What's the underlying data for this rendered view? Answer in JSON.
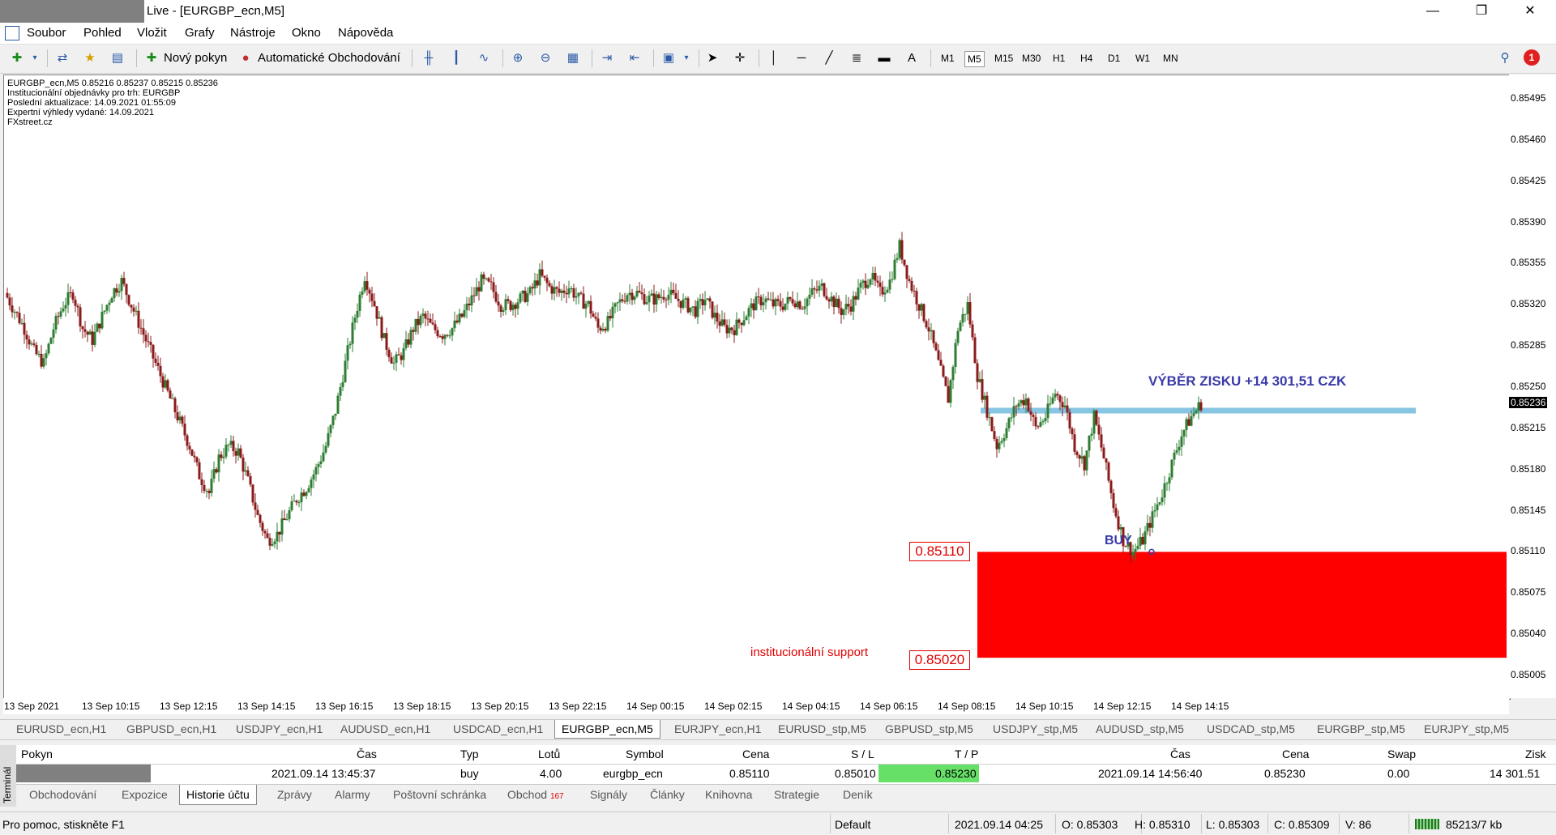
{
  "window": {
    "title": "Live - [EURGBP_ecn,M5]",
    "minimize": "—",
    "maximize": "❐",
    "close": "✕"
  },
  "menu": [
    "Soubor",
    "Pohled",
    "Vložit",
    "Grafy",
    "Nástroje",
    "Okno",
    "Nápověda"
  ],
  "toolbar": {
    "new_order": "Nový pokyn",
    "auto_trading": "Automatické Obchodování",
    "timeframes": [
      "M1",
      "M5",
      "M15",
      "M30",
      "H1",
      "H4",
      "D1",
      "W1",
      "MN"
    ],
    "active_timeframe": "M5",
    "text_tool": "A",
    "notifications": "1"
  },
  "chart_info": [
    "EURGBP_ecn,M5  0.85216 0.85237 0.85215 0.85236",
    "Institucionální objednávky pro trh: EURGBP",
    "Poslední aktualizace: 14.09.2021 01:55:09",
    "Expertní výhledy vydané: 14.09.2021",
    "FXstreet.cz"
  ],
  "annotations": {
    "take_profit": "VÝBĚR ZISKU +14 301,51 CZK",
    "buy": "BUY",
    "zone_label": "institucionální support",
    "zone_top": "0.85110",
    "zone_bottom": "0.85020"
  },
  "chart_data": {
    "type": "candlestick",
    "symbol": "EURGBP_ecn",
    "timeframe": "M5",
    "ylim": [
      0.84985,
      0.85515
    ],
    "y_ticks": [
      "0.85495",
      "0.85460",
      "0.85425",
      "0.85390",
      "0.85355",
      "0.85320",
      "0.85285",
      "0.85250",
      "0.85215",
      "0.85180",
      "0.85145",
      "0.85110",
      "0.85075",
      "0.85040",
      "0.85005"
    ],
    "current_price": "0.85236",
    "x_ticks": [
      "13 Sep 2021",
      "13 Sep 10:15",
      "13 Sep 12:15",
      "13 Sep 14:15",
      "13 Sep 16:15",
      "13 Sep 18:15",
      "13 Sep 20:15",
      "13 Sep 22:15",
      "14 Sep 00:15",
      "14 Sep 02:15",
      "14 Sep 04:15",
      "14 Sep 06:15",
      "14 Sep 08:15",
      "14 Sep 10:15",
      "14 Sep 12:15",
      "14 Sep 14:15"
    ],
    "price_path": [
      0.8533,
      0.85315,
      0.853,
      0.8528,
      0.8527,
      0.853,
      0.8532,
      0.8533,
      0.853,
      0.8529,
      0.8531,
      0.8533,
      0.8534,
      0.8532,
      0.853,
      0.8528,
      0.8526,
      0.8524,
      0.8522,
      0.852,
      0.85175,
      0.8516,
      0.8519,
      0.852,
      0.85195,
      0.8517,
      0.8514,
      0.8512,
      0.85125,
      0.8514,
      0.85155,
      0.85165,
      0.8518,
      0.852,
      0.8523,
      0.8527,
      0.8531,
      0.85345,
      0.8532,
      0.8529,
      0.8527,
      0.8528,
      0.853,
      0.8531,
      0.853,
      0.85295,
      0.853,
      0.8531,
      0.85325,
      0.8534,
      0.85335,
      0.8532,
      0.8532,
      0.85325,
      0.8533,
      0.85345,
      0.85335,
      0.8533,
      0.85335,
      0.85325,
      0.8532,
      0.853,
      0.85305,
      0.8532,
      0.8533,
      0.8533,
      0.85325,
      0.85325,
      0.8533,
      0.85325,
      0.8532,
      0.85315,
      0.85325,
      0.8531,
      0.853,
      0.853,
      0.8531,
      0.8532,
      0.85325,
      0.8532,
      0.8532,
      0.85325,
      0.8532,
      0.8533,
      0.85335,
      0.85325,
      0.85315,
      0.8532,
      0.85335,
      0.85345,
      0.8533,
      0.8534,
      0.8537,
      0.8534,
      0.8532,
      0.853,
      0.8527,
      0.8524,
      0.853,
      0.8532,
      0.8526,
      0.8523,
      0.852,
      0.85215,
      0.85235,
      0.8524,
      0.85215,
      0.85225,
      0.85245,
      0.85235,
      0.852,
      0.85185,
      0.85225,
      0.8519,
      0.8515,
      0.8512,
      0.8511,
      0.8512,
      0.8514,
      0.8516,
      0.85185,
      0.8521,
      0.85225,
      0.85236
    ],
    "buy_price": 0.8511,
    "take_profit_price": 0.8523,
    "support_zone": [
      0.8502,
      0.8511
    ]
  },
  "symbol_tabs": [
    "EURUSD_ecn,H1",
    "GBPUSD_ecn,H1",
    "USDJPY_ecn,H1",
    "AUDUSD_ecn,H1",
    "USDCAD_ecn,H1",
    "EURGBP_ecn,M5",
    "EURJPY_ecn,H1",
    "EURUSD_stp,M5",
    "GBPUSD_stp,M5",
    "USDJPY_stp,M5",
    "AUDUSD_stp,M5",
    "USDCAD_stp,M5",
    "EURGBP_stp,M5",
    "EURJPY_stp,M5"
  ],
  "active_symbol_tab": "EURGBP_ecn,M5",
  "terminal": {
    "side_label": "Terminál",
    "headers": [
      "Pokyn",
      "Čas",
      "Typ",
      "Lotů",
      "Symbol",
      "Cena",
      "S / L",
      "T / P",
      "Čas",
      "Cena",
      "Swap",
      "Zisk"
    ],
    "row": [
      "",
      "2021.09.14 13:45:37",
      "buy",
      "4.00",
      "eurgbp_ecn",
      "0.85110",
      "0.85010",
      "0.85230",
      "2021.09.14 14:56:40",
      "0.85230",
      "0.00",
      "14 301.51"
    ],
    "tp_color": "#66e066"
  },
  "bottom_tabs": [
    "Obchodování",
    "Expozice",
    "Historie účtu",
    "Zprávy",
    "Alarmy",
    "Poštovní schránka",
    "Obchod",
    "Signály",
    "Články",
    "Knihovna",
    "Strategie",
    "Deník"
  ],
  "bottom_tab_badge": "167",
  "status": {
    "help": "Pro pomoc, stiskněte F1",
    "profile": "Default",
    "datetime": "2021.09.14 04:25",
    "open": "O: 0.85303",
    "high": "H: 0.85310",
    "low": "L: 0.85303",
    "close": "C: 0.85309",
    "volume": "V: 86",
    "traffic": "85213/7 kb"
  }
}
